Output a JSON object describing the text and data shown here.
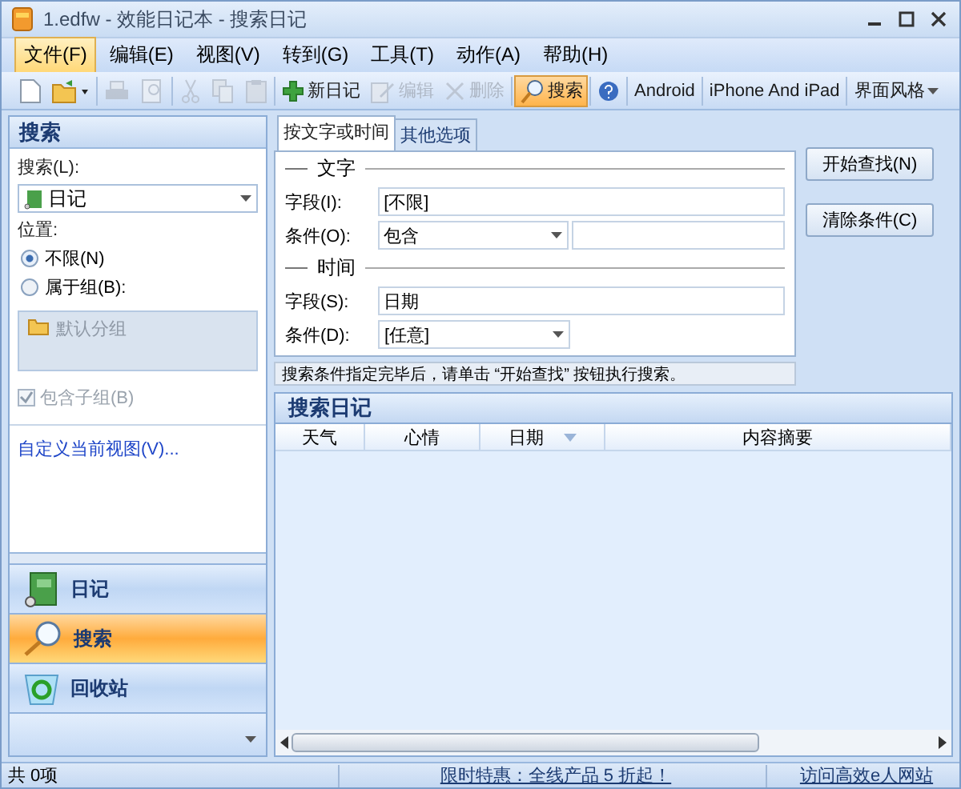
{
  "window": {
    "title": "1.edfw - 效能日记本 - 搜索日记"
  },
  "menu": [
    {
      "label": "文件(F)",
      "selected": true
    },
    {
      "label": "编辑(E)",
      "selected": false
    },
    {
      "label": "视图(V)",
      "selected": false
    },
    {
      "label": "转到(G)",
      "selected": false
    },
    {
      "label": "工具(T)",
      "selected": false
    },
    {
      "label": "动作(A)",
      "selected": false
    },
    {
      "label": "帮助(H)",
      "selected": false
    }
  ],
  "toolbar": [
    {
      "kind": "new"
    },
    {
      "kind": "open"
    },
    {
      "kind": "separator"
    },
    {
      "kind": "print",
      "disabled": true
    },
    {
      "kind": "preview",
      "disabled": true
    },
    {
      "kind": "separator"
    },
    {
      "kind": "cut",
      "disabled": true
    },
    {
      "kind": "copy",
      "disabled": true
    },
    {
      "kind": "paste",
      "disabled": true
    },
    {
      "kind": "separator"
    },
    {
      "kind": "add",
      "label": "新日记",
      "disabled": false
    },
    {
      "kind": "edit",
      "label": "编辑",
      "disabled": true
    },
    {
      "kind": "delete",
      "label": "删除",
      "disabled": true
    },
    {
      "kind": "separator"
    },
    {
      "kind": "search",
      "label": "搜索",
      "disabled": false,
      "selected": true
    },
    {
      "kind": "separator"
    },
    {
      "kind": "help"
    },
    {
      "kind": "separator"
    },
    {
      "kind": "text",
      "label": "Android"
    },
    {
      "kind": "separator"
    },
    {
      "kind": "text",
      "label": "iPhone And iPad"
    },
    {
      "kind": "separator"
    },
    {
      "kind": "dropdown",
      "label": "界面风格"
    }
  ],
  "left_panel": {
    "title": "搜索",
    "search_label": "搜索(L):",
    "search_value": "日记",
    "location_label": "位置:",
    "radios": [
      {
        "label": "不限(N)",
        "selected": true
      },
      {
        "label": "属于组(B):",
        "selected": false
      }
    ],
    "group": "默认分组",
    "include_subgroups": {
      "label": "包含子组(B)",
      "checked": true,
      "disabled": true
    },
    "custom_view_link": "自定义当前视图(V)..."
  },
  "nav": [
    {
      "kind": "diary",
      "label": "日记",
      "selected": false
    },
    {
      "kind": "search",
      "label": "搜索",
      "selected": true
    },
    {
      "kind": "recycle",
      "label": "回收站",
      "selected": false
    }
  ],
  "tabs": [
    {
      "label": "按文字或时间",
      "selected": true
    },
    {
      "label": "其他选项",
      "selected": false
    }
  ],
  "text_section": {
    "title": "文字",
    "field_label": "字段(I):",
    "field_value": "[不限]",
    "condition_label": "条件(O):",
    "condition_value": "包含"
  },
  "time_section": {
    "title": "时间",
    "field_label": "字段(S):",
    "field_value": "日期",
    "condition_label": "条件(D):",
    "condition_value": "[任意]"
  },
  "buttons": [
    "开始查找(N)",
    "清除条件(C)"
  ],
  "hint": "搜索条件指定完毕后，请单击 “开始查找” 按钮执行搜索。",
  "results": {
    "title": "搜索日记",
    "columns": [
      {
        "label": "天气",
        "sorted": false
      },
      {
        "label": "心情",
        "sorted": false
      },
      {
        "label": "日期",
        "sorted": true
      },
      {
        "label": "内容摘要",
        "sorted": false
      }
    ]
  },
  "status_bar": {
    "count": "共 0项",
    "promo": "限时特惠：全线产品 5 折起！",
    "site_link": "访问高效e人网站"
  }
}
